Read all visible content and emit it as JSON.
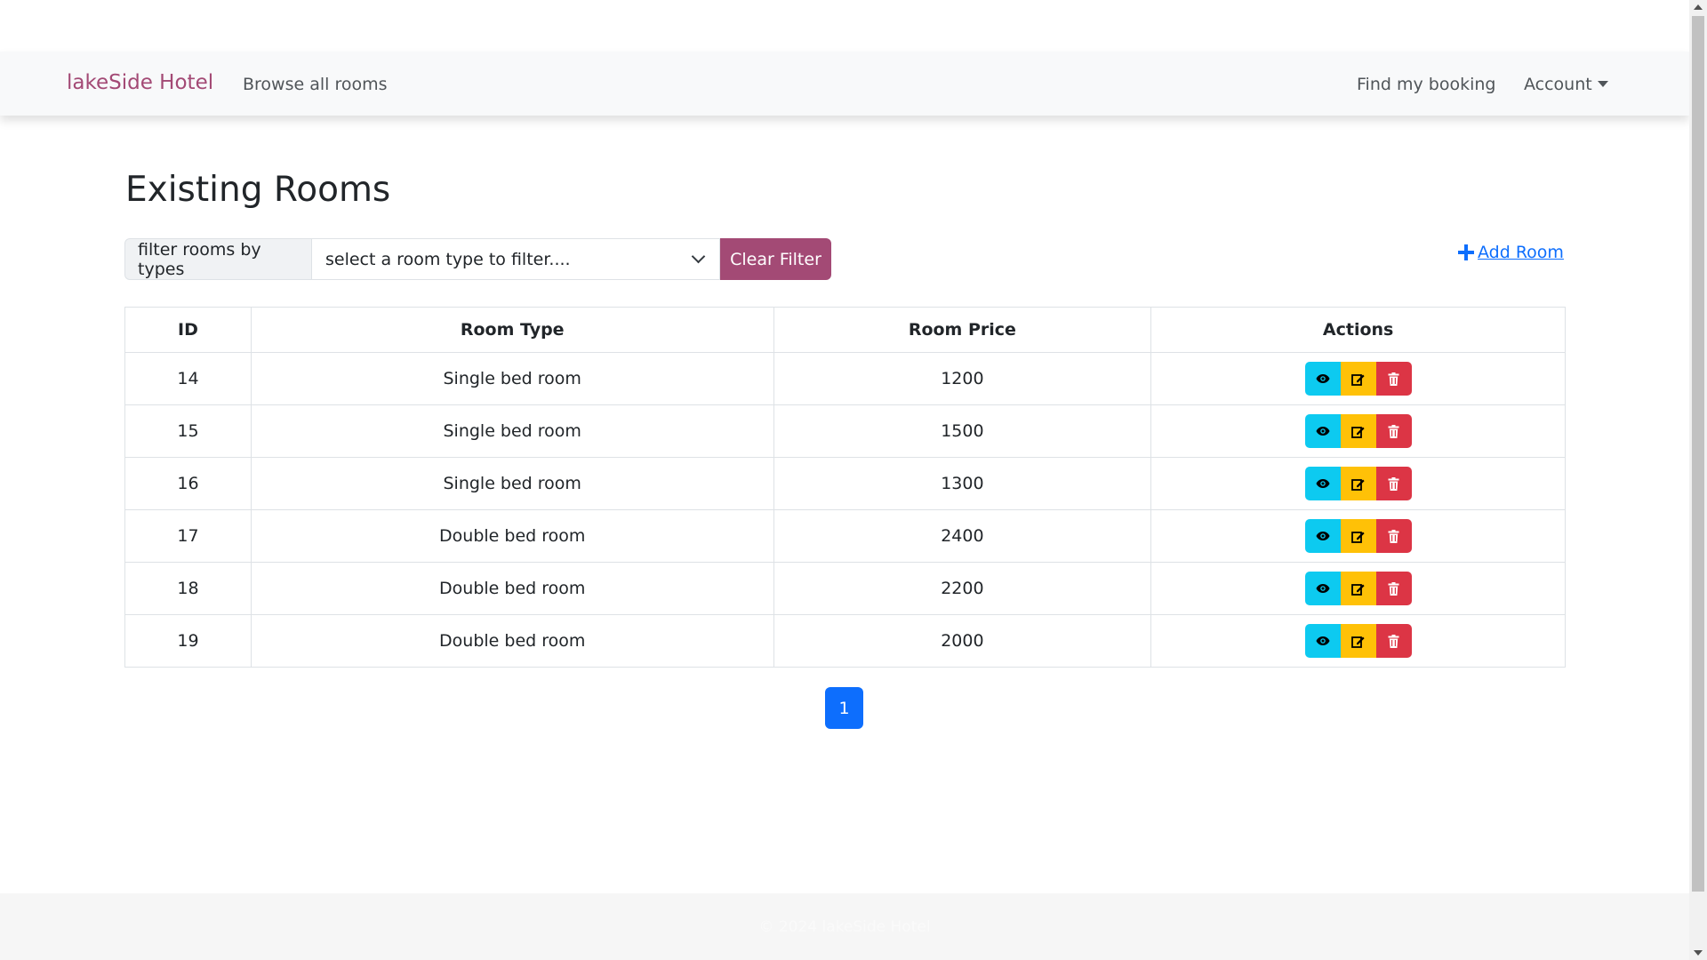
{
  "navbar": {
    "brand": "lakeSide Hotel",
    "browse_label": "Browse all rooms",
    "find_booking_label": "Find my booking",
    "account_label": "Account"
  },
  "main": {
    "title": "Existing Rooms",
    "filter": {
      "label": "filter rooms by types",
      "placeholder": "select a room type to filter....",
      "clear_label": "Clear Filter"
    },
    "add_room_label": " Add Room",
    "table": {
      "headers": [
        "ID",
        "Room Type",
        "Room Price",
        "Actions"
      ],
      "rows": [
        {
          "id": "14",
          "type": "Single bed room",
          "price": "1200"
        },
        {
          "id": "15",
          "type": "Single bed room",
          "price": "1500"
        },
        {
          "id": "16",
          "type": "Single bed room",
          "price": "1300"
        },
        {
          "id": "17",
          "type": "Double bed room",
          "price": "2400"
        },
        {
          "id": "18",
          "type": "Double bed room",
          "price": "2200"
        },
        {
          "id": "19",
          "type": "Double bed room",
          "price": "2000"
        }
      ],
      "action_icons": [
        "eye-icon",
        "edit-icon",
        "trash-icon"
      ]
    },
    "pagination": {
      "current_page": "1"
    }
  },
  "footer": {
    "text": "© 2024 lakeSide Hotel"
  },
  "colors": {
    "brand": "#a34a75",
    "primary": "#0d6efd",
    "info": "#0dcaf0",
    "warning": "#ffc107",
    "danger": "#dc3545",
    "navbar_bg": "#f8f9fa"
  }
}
